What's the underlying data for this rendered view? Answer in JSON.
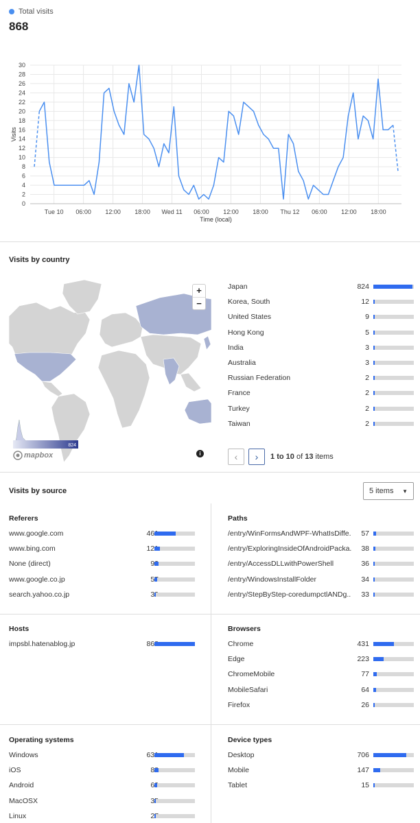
{
  "header": {
    "legend_label": "Total visits",
    "total": "868"
  },
  "chart_data": {
    "type": "line",
    "ylabel": "Visits",
    "xlabel": "Time (local)",
    "ylim": [
      0,
      30
    ],
    "yticks": [
      0,
      2,
      4,
      6,
      8,
      10,
      12,
      14,
      16,
      18,
      20,
      22,
      24,
      26,
      28,
      30
    ],
    "xtick_labels": [
      "Tue 10",
      "06:00",
      "12:00",
      "18:00",
      "Wed 11",
      "06:00",
      "12:00",
      "18:00",
      "Thu 12",
      "06:00",
      "12:00",
      "18:00"
    ],
    "xtick_hours": [
      0,
      6,
      12,
      18,
      24,
      30,
      36,
      42,
      48,
      54,
      60,
      66
    ],
    "x_start_hour": -4,
    "x_end_hour": 70,
    "series": [
      {
        "values": [
          8,
          20,
          22,
          9,
          4,
          4,
          4,
          4,
          4,
          4,
          4,
          5,
          2,
          9,
          24,
          25,
          20,
          17,
          15,
          26,
          22,
          30,
          15,
          14,
          12,
          8,
          13,
          11,
          21,
          6,
          3,
          2,
          4,
          1,
          2,
          1,
          4,
          10,
          9,
          20,
          19,
          15,
          22,
          21,
          20,
          17,
          15,
          14,
          12,
          12,
          1,
          15,
          13,
          7,
          5,
          1,
          4,
          3,
          2,
          2,
          5,
          8,
          10,
          19,
          24,
          14,
          19,
          18,
          14,
          27,
          16,
          16,
          17,
          7
        ],
        "dashed_first": true,
        "dashed_last": true
      }
    ]
  },
  "country": {
    "title": "Visits by country",
    "items": [
      {
        "name": "Japan",
        "value": "824",
        "frac": 0.96
      },
      {
        "name": "Korea, South",
        "value": "12",
        "frac": 0.02
      },
      {
        "name": "United States",
        "value": "9",
        "frac": 0.015
      },
      {
        "name": "Hong Kong",
        "value": "5",
        "frac": 0.01
      },
      {
        "name": "India",
        "value": "3",
        "frac": 0.008
      },
      {
        "name": "Australia",
        "value": "3",
        "frac": 0.008
      },
      {
        "name": "Russian Federation",
        "value": "2",
        "frac": 0.006
      },
      {
        "name": "France",
        "value": "2",
        "frac": 0.006
      },
      {
        "name": "Turkey",
        "value": "2",
        "frac": 0.006
      },
      {
        "name": "Taiwan",
        "value": "2",
        "frac": 0.006
      }
    ],
    "pager": {
      "from": "1",
      "to": "10",
      "total": "13",
      "to_word": "to",
      "of_word": "of",
      "items_word": "items"
    },
    "map": {
      "zoom_in": "+",
      "zoom_out": "−",
      "scale_max": "824",
      "logo": "mapbox",
      "info": "i"
    }
  },
  "source": {
    "title": "Visits by source",
    "select_value": "5 items",
    "referers": {
      "title": "Referers",
      "items": [
        {
          "name": "www.google.com",
          "value": "461",
          "frac": 0.53
        },
        {
          "name": "www.bing.com",
          "value": "121",
          "frac": 0.14
        },
        {
          "name": "None (direct)",
          "value": "92",
          "frac": 0.1
        },
        {
          "name": "www.google.co.jp",
          "value": "57",
          "frac": 0.065
        },
        {
          "name": "search.yahoo.co.jp",
          "value": "32",
          "frac": 0.04
        }
      ]
    },
    "paths": {
      "title": "Paths",
      "items": [
        {
          "name": "/entry/WinFormsAndWPF-WhatIsDiffe...",
          "value": "57",
          "frac": 0.065
        },
        {
          "name": "/entry/ExploringInsideOfAndroidPacka...",
          "value": "38",
          "frac": 0.045
        },
        {
          "name": "/entry/AccessDLLwithPowerShell",
          "value": "36",
          "frac": 0.042
        },
        {
          "name": "/entry/WindowsInstallFolder",
          "value": "34",
          "frac": 0.04
        },
        {
          "name": "/entry/StepByStep-coredumpctlANDg...",
          "value": "33",
          "frac": 0.038
        }
      ]
    },
    "hosts": {
      "title": "Hosts",
      "items": [
        {
          "name": "impsbl.hatenablog.jp",
          "value": "868",
          "frac": 1.0
        }
      ]
    },
    "browsers": {
      "title": "Browsers",
      "items": [
        {
          "name": "Chrome",
          "value": "431",
          "frac": 0.5
        },
        {
          "name": "Edge",
          "value": "223",
          "frac": 0.26
        },
        {
          "name": "ChromeMobile",
          "value": "77",
          "frac": 0.09
        },
        {
          "name": "MobileSafari",
          "value": "64",
          "frac": 0.075
        },
        {
          "name": "Firefox",
          "value": "26",
          "frac": 0.03
        }
      ]
    },
    "os": {
      "title": "Operating systems",
      "items": [
        {
          "name": "Windows",
          "value": "631",
          "frac": 0.73
        },
        {
          "name": "iOS",
          "value": "88",
          "frac": 0.1
        },
        {
          "name": "Android",
          "value": "63",
          "frac": 0.073
        },
        {
          "name": "MacOSX",
          "value": "35",
          "frac": 0.04
        },
        {
          "name": "Linux",
          "value": "27",
          "frac": 0.031
        }
      ]
    },
    "devices": {
      "title": "Device types",
      "items": [
        {
          "name": "Desktop",
          "value": "706",
          "frac": 0.81
        },
        {
          "name": "Mobile",
          "value": "147",
          "frac": 0.17
        },
        {
          "name": "Tablet",
          "value": "15",
          "frac": 0.017
        }
      ]
    }
  },
  "colors": {
    "line": "#4a8ff0",
    "bar_fill": "#2f6bef",
    "bar_track": "#d9d9d9",
    "map_land": "#d4d4d4",
    "map_highlight": "#a8b2d2"
  }
}
